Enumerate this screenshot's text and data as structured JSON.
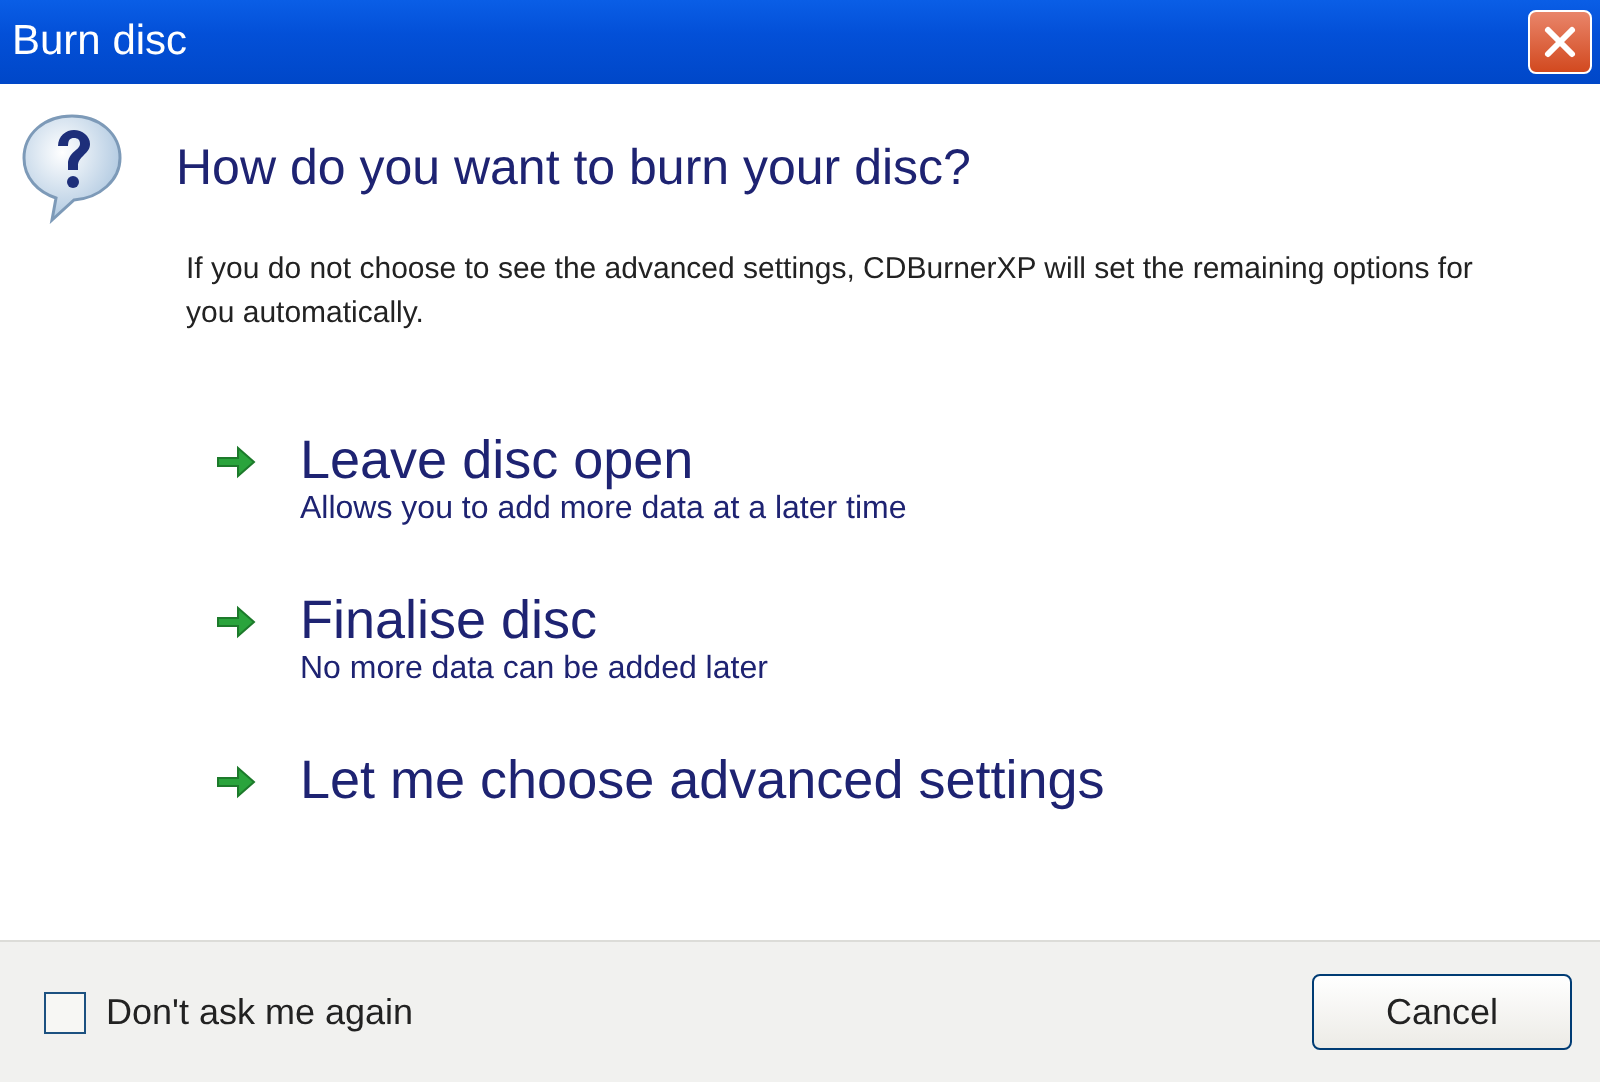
{
  "window": {
    "title": "Burn disc"
  },
  "heading": "How do you want to burn your disc?",
  "description": "If you do not choose to see the advanced settings, CDBurnerXP will set the remaining options for you automatically.",
  "options": [
    {
      "title": "Leave disc open",
      "description": "Allows you to add more data at a later time"
    },
    {
      "title": "Finalise disc",
      "description": "No more data can be added later"
    },
    {
      "title": "Let me choose advanced settings"
    }
  ],
  "checkbox": {
    "label": "Don't ask me again",
    "checked": false
  },
  "buttons": [
    "Cancel"
  ]
}
